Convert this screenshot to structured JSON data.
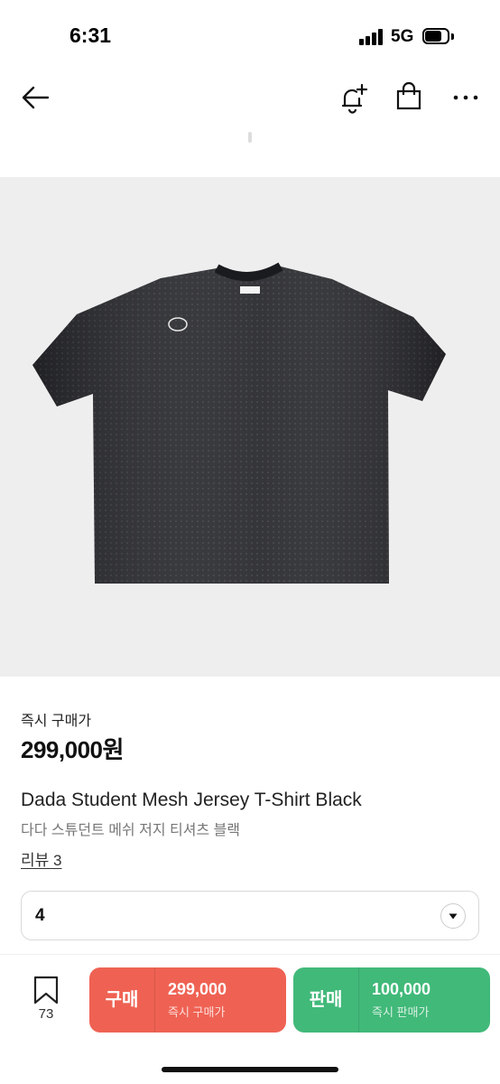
{
  "status_bar": {
    "time": "6:31",
    "network": "5G",
    "icons": [
      "signal-bars-icon",
      "battery-icon"
    ]
  },
  "nav": {
    "icons": [
      "back-arrow-icon",
      "notification-bell-plus-icon",
      "shopping-bag-icon",
      "more-horizontal-icon"
    ]
  },
  "product": {
    "image_subject": "black-mesh-jersey-tshirt",
    "price_label": "즉시 구매가",
    "price": "299,000원",
    "title_en": "Dada Student Mesh Jersey T-Shirt Black",
    "title_ko": "다다 스튜던트 메쉬 저지 티셔츠 블랙",
    "reviews_label": "리뷰 3"
  },
  "size_select": {
    "value": "4",
    "icon": "chevron-down-icon"
  },
  "bottom_bar": {
    "wish_count": "73",
    "buy": {
      "label": "구매",
      "price": "299,000",
      "sub": "즉시 구매가",
      "color": "#ef6253"
    },
    "sell": {
      "label": "판매",
      "price": "100,000",
      "sub": "즉시 판매가",
      "color": "#41b979"
    }
  }
}
